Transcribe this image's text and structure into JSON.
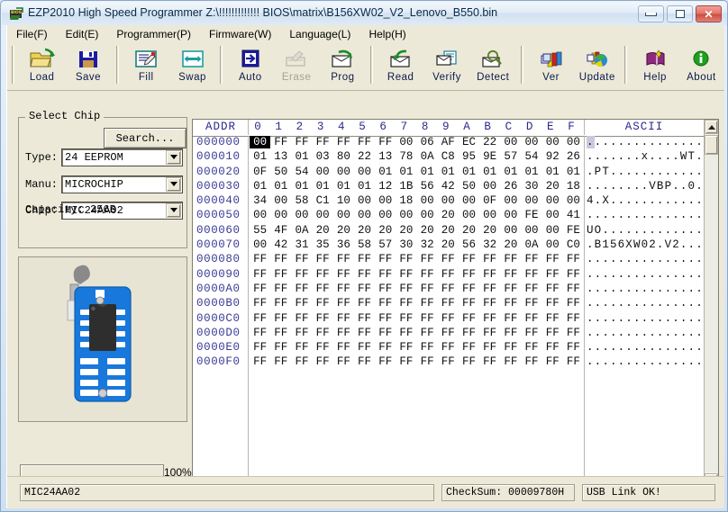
{
  "window": {
    "title": "EZP2010 High Speed Programmer   Z:\\!!!!!!!!!!!!! BIOS\\matrix\\B156XW02_V2_Lenovo_B550.bin",
    "icon": "bios-chip-icon",
    "minimize_label": "Minimize",
    "maximize_label": "Maximize",
    "close_label": "Close"
  },
  "menu": {
    "items": [
      {
        "label": "File(F)",
        "name": "menu-file"
      },
      {
        "label": "Edit(E)",
        "name": "menu-edit"
      },
      {
        "label": "Programmer(P)",
        "name": "menu-programmer"
      },
      {
        "label": "Firmware(W)",
        "name": "menu-firmware"
      },
      {
        "label": "Language(L)",
        "name": "menu-language"
      },
      {
        "label": "Help(H)",
        "name": "menu-help"
      }
    ]
  },
  "toolbar": {
    "buttons": [
      {
        "label": "Load",
        "icon": "open-folder-icon",
        "enabled": true
      },
      {
        "label": "Save",
        "icon": "floppy-disk-icon",
        "enabled": true
      },
      {
        "label": "Fill",
        "icon": "fill-pen-icon",
        "enabled": true
      },
      {
        "label": "Swap",
        "icon": "swap-arrows-icon",
        "enabled": true
      },
      {
        "label": "Auto",
        "icon": "auto-arrow-icon",
        "enabled": true
      },
      {
        "label": "Erase",
        "icon": "erase-icon",
        "enabled": false
      },
      {
        "label": "Prog",
        "icon": "program-chip-icon",
        "enabled": true
      },
      {
        "label": "Read",
        "icon": "read-chip-icon",
        "enabled": true
      },
      {
        "label": "Verify",
        "icon": "verify-icon",
        "enabled": true
      },
      {
        "label": "Detect",
        "icon": "magnifier-icon",
        "enabled": true
      },
      {
        "label": "Ver",
        "icon": "version-books-icon",
        "enabled": true
      },
      {
        "label": "Update",
        "icon": "update-globe-icon",
        "enabled": true
      },
      {
        "label": "Help",
        "icon": "help-book-icon",
        "enabled": true
      },
      {
        "label": "About",
        "icon": "info-icon",
        "enabled": true
      }
    ]
  },
  "select_chip": {
    "group_title": "Select Chip",
    "search_button": "Search...",
    "type_label": "Type:",
    "type_value": "24 EEPROM",
    "manu_label": "Manu:",
    "manu_value": "MICROCHIP",
    "chip_label": "Chip:",
    "chip_value": "MIC24AA02",
    "capacity": "Capacity: 256B",
    "socket_image": "zif-socket-with-dip8-chip"
  },
  "progress": {
    "percent_label": "100%",
    "value": 100
  },
  "hex_editor": {
    "addr_header": "ADDR",
    "column_headers": [
      "0",
      "1",
      "2",
      "3",
      "4",
      "5",
      "6",
      "7",
      "8",
      "9",
      "A",
      "B",
      "C",
      "D",
      "E",
      "F"
    ],
    "ascii_header": "ASCII",
    "cursor_cell": {
      "row": 0,
      "col": 0
    },
    "rows": [
      {
        "addr": "000000",
        "bytes": [
          "00",
          "FF",
          "FF",
          "FF",
          "FF",
          "FF",
          "FF",
          "00",
          "06",
          "AF",
          "EC",
          "22",
          "00",
          "00",
          "00",
          "00"
        ],
        "ascii": "................"
      },
      {
        "addr": "000010",
        "bytes": [
          "01",
          "13",
          "01",
          "03",
          "80",
          "22",
          "13",
          "78",
          "0A",
          "C8",
          "95",
          "9E",
          "57",
          "54",
          "92",
          "26"
        ],
        "ascii": ".......x....WT.."
      },
      {
        "addr": "000020",
        "bytes": [
          "0F",
          "50",
          "54",
          "00",
          "00",
          "00",
          "01",
          "01",
          "01",
          "01",
          "01",
          "01",
          "01",
          "01",
          "01",
          "01"
        ],
        "ascii": ".PT............."
      },
      {
        "addr": "000030",
        "bytes": [
          "01",
          "01",
          "01",
          "01",
          "01",
          "01",
          "12",
          "1B",
          "56",
          "42",
          "50",
          "00",
          "26",
          "30",
          "20",
          "18"
        ],
        "ascii": "........VBP..0.."
      },
      {
        "addr": "000040",
        "bytes": [
          "34",
          "00",
          "58",
          "C1",
          "10",
          "00",
          "00",
          "18",
          "00",
          "00",
          "00",
          "0F",
          "00",
          "00",
          "00",
          "00"
        ],
        "ascii": "4.X............."
      },
      {
        "addr": "000050",
        "bytes": [
          "00",
          "00",
          "00",
          "00",
          "00",
          "00",
          "00",
          "00",
          "00",
          "20",
          "00",
          "00",
          "00",
          "FE",
          "00",
          "41"
        ],
        "ascii": "...............A"
      },
      {
        "addr": "000060",
        "bytes": [
          "55",
          "4F",
          "0A",
          "20",
          "20",
          "20",
          "20",
          "20",
          "20",
          "20",
          "20",
          "20",
          "00",
          "00",
          "00",
          "FE"
        ],
        "ascii": "UO.............."
      },
      {
        "addr": "000070",
        "bytes": [
          "00",
          "42",
          "31",
          "35",
          "36",
          "58",
          "57",
          "30",
          "32",
          "20",
          "56",
          "32",
          "20",
          "0A",
          "00",
          "C0"
        ],
        "ascii": ".B156XW02.V2...."
      },
      {
        "addr": "000080",
        "bytes": [
          "FF",
          "FF",
          "FF",
          "FF",
          "FF",
          "FF",
          "FF",
          "FF",
          "FF",
          "FF",
          "FF",
          "FF",
          "FF",
          "FF",
          "FF",
          "FF"
        ],
        "ascii": "................"
      },
      {
        "addr": "000090",
        "bytes": [
          "FF",
          "FF",
          "FF",
          "FF",
          "FF",
          "FF",
          "FF",
          "FF",
          "FF",
          "FF",
          "FF",
          "FF",
          "FF",
          "FF",
          "FF",
          "FF"
        ],
        "ascii": "................"
      },
      {
        "addr": "0000A0",
        "bytes": [
          "FF",
          "FF",
          "FF",
          "FF",
          "FF",
          "FF",
          "FF",
          "FF",
          "FF",
          "FF",
          "FF",
          "FF",
          "FF",
          "FF",
          "FF",
          "FF"
        ],
        "ascii": "................"
      },
      {
        "addr": "0000B0",
        "bytes": [
          "FF",
          "FF",
          "FF",
          "FF",
          "FF",
          "FF",
          "FF",
          "FF",
          "FF",
          "FF",
          "FF",
          "FF",
          "FF",
          "FF",
          "FF",
          "FF"
        ],
        "ascii": "................"
      },
      {
        "addr": "0000C0",
        "bytes": [
          "FF",
          "FF",
          "FF",
          "FF",
          "FF",
          "FF",
          "FF",
          "FF",
          "FF",
          "FF",
          "FF",
          "FF",
          "FF",
          "FF",
          "FF",
          "FF"
        ],
        "ascii": "................"
      },
      {
        "addr": "0000D0",
        "bytes": [
          "FF",
          "FF",
          "FF",
          "FF",
          "FF",
          "FF",
          "FF",
          "FF",
          "FF",
          "FF",
          "FF",
          "FF",
          "FF",
          "FF",
          "FF",
          "FF"
        ],
        "ascii": "................"
      },
      {
        "addr": "0000E0",
        "bytes": [
          "FF",
          "FF",
          "FF",
          "FF",
          "FF",
          "FF",
          "FF",
          "FF",
          "FF",
          "FF",
          "FF",
          "FF",
          "FF",
          "FF",
          "FF",
          "FF"
        ],
        "ascii": "................"
      },
      {
        "addr": "0000F0",
        "bytes": [
          "FF",
          "FF",
          "FF",
          "FF",
          "FF",
          "FF",
          "FF",
          "FF",
          "FF",
          "FF",
          "FF",
          "FF",
          "FF",
          "FF",
          "FF",
          "FF"
        ],
        "ascii": "................"
      }
    ]
  },
  "status_bar": {
    "chip": "MIC24AA02",
    "checksum": "CheckSum: 00009780H",
    "usb": "USB Link OK!"
  },
  "colors": {
    "addr_blue": "#3b3b96",
    "header_blue": "#2a2a8c",
    "panel_bg": "#ece9d8",
    "socket_blue": "#1878dc",
    "titlebar_text": "#0b2a4a"
  }
}
